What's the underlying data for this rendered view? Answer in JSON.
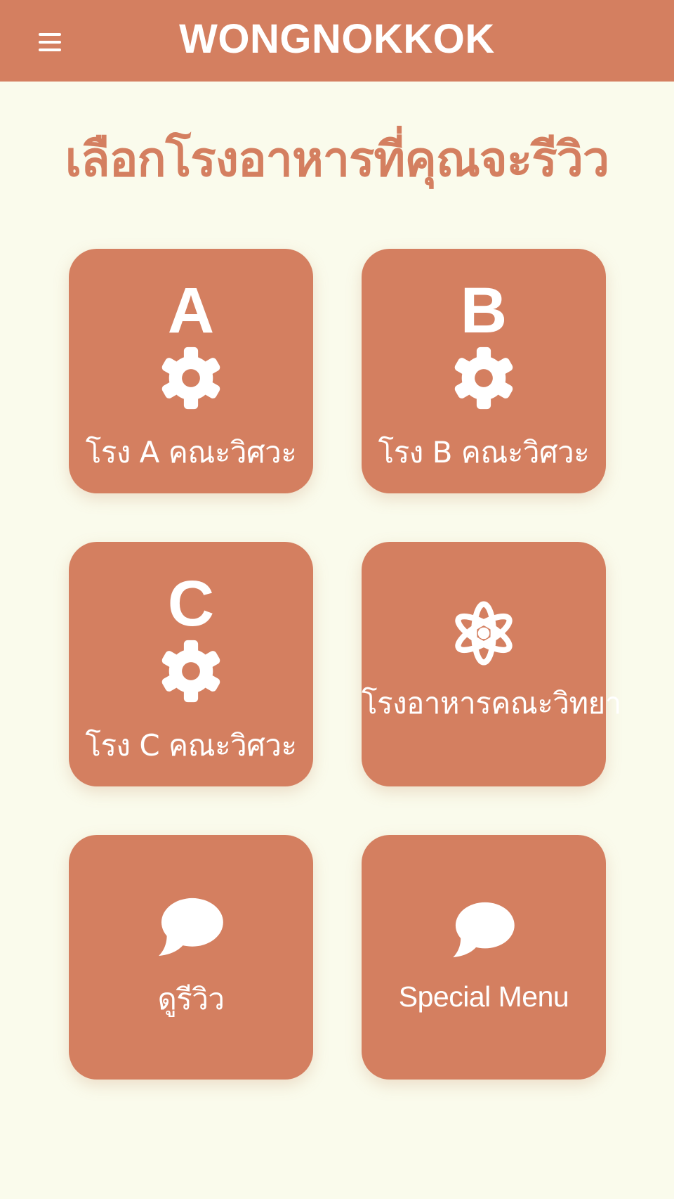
{
  "header": {
    "menu_icon": "hamburger-icon",
    "app_title": "WONGNOKKOK",
    "background_color": "#d47f60"
  },
  "main": {
    "title": "เลือกโรงอาหารที่คุณจะรีวิว",
    "title_color": "#d47f60",
    "background_color": "#fafbec"
  },
  "cards": [
    {
      "letter": "A",
      "icon": "gear-icon",
      "label": "โรง A คณะวิศวะ"
    },
    {
      "letter": "B",
      "icon": "gear-icon",
      "label": "โรง B คณะวิศวะ"
    },
    {
      "letter": "C",
      "icon": "gear-icon",
      "label": "โรง C คณะวิศวะ"
    },
    {
      "letter": "",
      "icon": "atom-icon",
      "label": "โรงอาหารคณะวิทยา"
    },
    {
      "letter": "",
      "icon": "speech-bubble-icon",
      "label": "ดูรีวิว"
    },
    {
      "letter": "",
      "icon": "speech-bubble-icon",
      "label": "Special Menu"
    }
  ]
}
